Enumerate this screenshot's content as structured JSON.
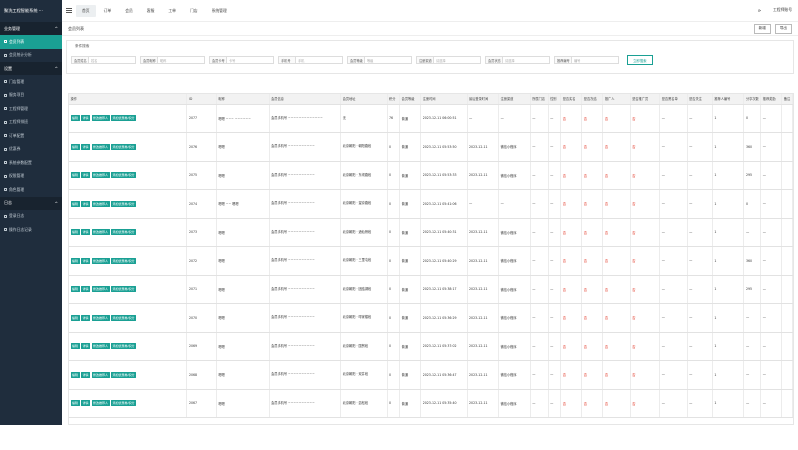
{
  "sidebar": {
    "brand": "聚洗工程智能系统 ···",
    "groups": [
      {
        "label": "业务管理",
        "chevron": "^"
      },
      {
        "label": "设置",
        "chevron": "^"
      },
      {
        "label": "日志",
        "chevron": "^"
      }
    ],
    "items_a": [
      {
        "label": "会员列表",
        "active": true
      },
      {
        "label": "会员统计分析",
        "active": false
      }
    ],
    "items_b": [
      {
        "label": "门店管理"
      },
      {
        "label": "服务项目"
      },
      {
        "label": "工程师管理"
      },
      {
        "label": "工程师排班"
      },
      {
        "label": "订单配置"
      },
      {
        "label": "优惠券"
      },
      {
        "label": "系统参数配置"
      },
      {
        "label": "权限管理"
      },
      {
        "label": "角色管理"
      }
    ],
    "items_c": [
      {
        "label": "登录日志"
      },
      {
        "label": "操作日志记录"
      }
    ]
  },
  "topbar": {
    "tabs": [
      "首页",
      "订单",
      "会员",
      "客服",
      "工单",
      "门店",
      "系统管理"
    ],
    "active_tab": 0,
    "refresh_icon": "refresh-icon",
    "user_label": "工程师账号"
  },
  "page": {
    "title": "会员列表",
    "actions": [
      "新增",
      "导出"
    ]
  },
  "search": {
    "title": "条件搜索",
    "fields": [
      {
        "label": "会员姓名",
        "placeholder": "姓名"
      },
      {
        "label": "会员昵称",
        "placeholder": "昵称"
      },
      {
        "label": "会员卡号",
        "placeholder": "卡号"
      },
      {
        "label": "手机号",
        "placeholder": "手机"
      },
      {
        "label": "会员等级",
        "placeholder": "等级"
      },
      {
        "label": "注册渠道",
        "placeholder": "请选择"
      },
      {
        "label": "会员状态",
        "placeholder": "请选择"
      },
      {
        "label": "推荐编号",
        "placeholder": "编号"
      }
    ],
    "button": "立即搜索"
  },
  "table": {
    "headers": [
      "操作",
      "ID",
      "昵称",
      "会员信息",
      "会员地址",
      "积分",
      "会员等级",
      "注册时间",
      "最后登录时间",
      "注册渠道",
      "所属门店",
      "性别",
      "是否实名",
      "是否冻结",
      "推广人",
      "是否推广员",
      "是否黑名单",
      "是否关注",
      "推荐人编号",
      "分享次数",
      "推荐奖励",
      "备注"
    ],
    "ops": [
      "编辑",
      "详情",
      "修改推荐人",
      "添加优惠券/积分"
    ],
    "rows": [
      {
        "id": "2077",
        "nick": "嗯嗯 ~~~ ~~~~~~",
        "info": "会员手机号 ~~~~~~~~~~~~~",
        "addr": "无",
        "pts": "76",
        "level": "普通",
        "reg": "2023-12-11 06:00:51",
        "last": "一",
        "ch": "一",
        "store": "一",
        "sex": "一",
        "real": "否",
        "frozen": "否",
        "prom": "否",
        "ispro": "否",
        "black": "一",
        "follow": "一",
        "ref": "1",
        "share": "0",
        "rew": "一"
      },
      {
        "id": "2076",
        "nick": "嗯嗯",
        "info": "会员手机号 ~~~~~~~~~~",
        "addr": "北京朝阳 · 朝阳路段",
        "pts": "0",
        "level": "普通",
        "reg": "2023-12-11 05:53:50",
        "last": "2023-12-11",
        "ch": "微信小程序",
        "store": "一",
        "sex": "一",
        "real": "否",
        "frozen": "否",
        "prom": "否",
        "ispro": "否",
        "black": "一",
        "follow": "一",
        "ref": "1",
        "share": "360",
        "rew": "一"
      },
      {
        "id": "2075",
        "nick": "嗯嗯",
        "info": "会员手机号 ~~~~~~~~~~",
        "addr": "北京朝阳 · 东坝路段",
        "pts": "0",
        "level": "普通",
        "reg": "2023-12-11 05:53:33",
        "last": "2023-12-11",
        "ch": "微信小程序",
        "store": "一",
        "sex": "一",
        "real": "否",
        "frozen": "否",
        "prom": "否",
        "ispro": "否",
        "black": "一",
        "follow": "一",
        "ref": "1",
        "share": "295",
        "rew": "一"
      },
      {
        "id": "2074",
        "nick": "嗯嗯 ~~ 嗯嗯",
        "info": "会员手机号 ~~~~~~~~~~",
        "addr": "北京朝阳 · 望京路段",
        "pts": "0",
        "level": "普通",
        "reg": "2023-12-11 05:41:06",
        "last": "一",
        "ch": "一",
        "store": "一",
        "sex": "一",
        "real": "否",
        "frozen": "否",
        "prom": "否",
        "ispro": "否",
        "black": "一",
        "follow": "一",
        "ref": "1",
        "share": "0",
        "rew": "一"
      },
      {
        "id": "2073",
        "nick": "嗯嗯",
        "info": "会员手机号 ~~~~~~~~~~",
        "addr": "北京朝阳 · 酒仙桥段",
        "pts": "0",
        "level": "普通",
        "reg": "2023-12-11 05:40:31",
        "last": "2023-12-11",
        "ch": "微信小程序",
        "store": "一",
        "sex": "一",
        "real": "否",
        "frozen": "否",
        "prom": "否",
        "ispro": "否",
        "black": "一",
        "follow": "一",
        "ref": "1",
        "share": "一",
        "rew": "一"
      },
      {
        "id": "2072",
        "nick": "嗯嗯",
        "info": "会员手机号 ~~~~~~~~~~",
        "addr": "北京朝阳 · 三里屯段",
        "pts": "0",
        "level": "普通",
        "reg": "2023-12-11 05:40:29",
        "last": "2023-12-11",
        "ch": "微信小程序",
        "store": "一",
        "sex": "一",
        "real": "否",
        "frozen": "否",
        "prom": "否",
        "ispro": "否",
        "black": "一",
        "follow": "一",
        "ref": "1",
        "share": "360",
        "rew": "一"
      },
      {
        "id": "2071",
        "nick": "嗯嗯",
        "info": "会员手机号 ~~~~~~~~~~",
        "addr": "北京朝阳 · 团结湖段",
        "pts": "0",
        "level": "普通",
        "reg": "2023-12-11 05:38:17",
        "last": "2023-12-11",
        "ch": "微信小程序",
        "store": "一",
        "sex": "一",
        "real": "否",
        "frozen": "否",
        "prom": "否",
        "ispro": "否",
        "black": "一",
        "follow": "一",
        "ref": "1",
        "share": "295",
        "rew": "一"
      },
      {
        "id": "2070",
        "nick": "嗯嗯",
        "info": "会员手机号 ~~~~~~~~~~",
        "addr": "北京朝阳 · 呼家楼段",
        "pts": "0",
        "level": "普通",
        "reg": "2023-12-11 05:36:29",
        "last": "2023-12-11",
        "ch": "微信小程序",
        "store": "一",
        "sex": "一",
        "real": "否",
        "frozen": "否",
        "prom": "否",
        "ispro": "否",
        "black": "一",
        "follow": "一",
        "ref": "1",
        "share": "一",
        "rew": "一"
      },
      {
        "id": "2069",
        "nick": "嗯嗯",
        "info": "会员手机号 ~~~~~~~~~~",
        "addr": "北京朝阳 · 国贸段",
        "pts": "0",
        "level": "普通",
        "reg": "2023-12-11 05:37:02",
        "last": "2023-12-11",
        "ch": "微信小程序",
        "store": "一",
        "sex": "一",
        "real": "否",
        "frozen": "否",
        "prom": "否",
        "ispro": "否",
        "black": "一",
        "follow": "一",
        "ref": "1",
        "share": "一",
        "rew": "一"
      },
      {
        "id": "2068",
        "nick": "嗯嗯",
        "info": "会员手机号 ~~~~~~~~~~",
        "addr": "北京朝阳 · 双井段",
        "pts": "0",
        "level": "普通",
        "reg": "2023-12-11 05:36:47",
        "last": "2023-12-11",
        "ch": "微信小程序",
        "store": "一",
        "sex": "一",
        "real": "否",
        "frozen": "否",
        "prom": "否",
        "ispro": "否",
        "black": "一",
        "follow": "一",
        "ref": "1",
        "share": "一",
        "rew": "一"
      },
      {
        "id": "2067",
        "nick": "嗯嗯",
        "info": "会员手机号 ~~~~~~~~~~",
        "addr": "北京朝阳 · 劲松段",
        "pts": "0",
        "level": "普通",
        "reg": "2023-12-11 05:35:40",
        "last": "2023-12-11",
        "ch": "微信小程序",
        "store": "一",
        "sex": "一",
        "real": "否",
        "frozen": "否",
        "prom": "否",
        "ispro": "否",
        "black": "一",
        "follow": "一",
        "ref": "1",
        "share": "一",
        "rew": "一"
      }
    ]
  },
  "colors": {
    "accent": "#1aa094",
    "sidebar": "#1f2d3d",
    "flag": "#e0301e"
  }
}
